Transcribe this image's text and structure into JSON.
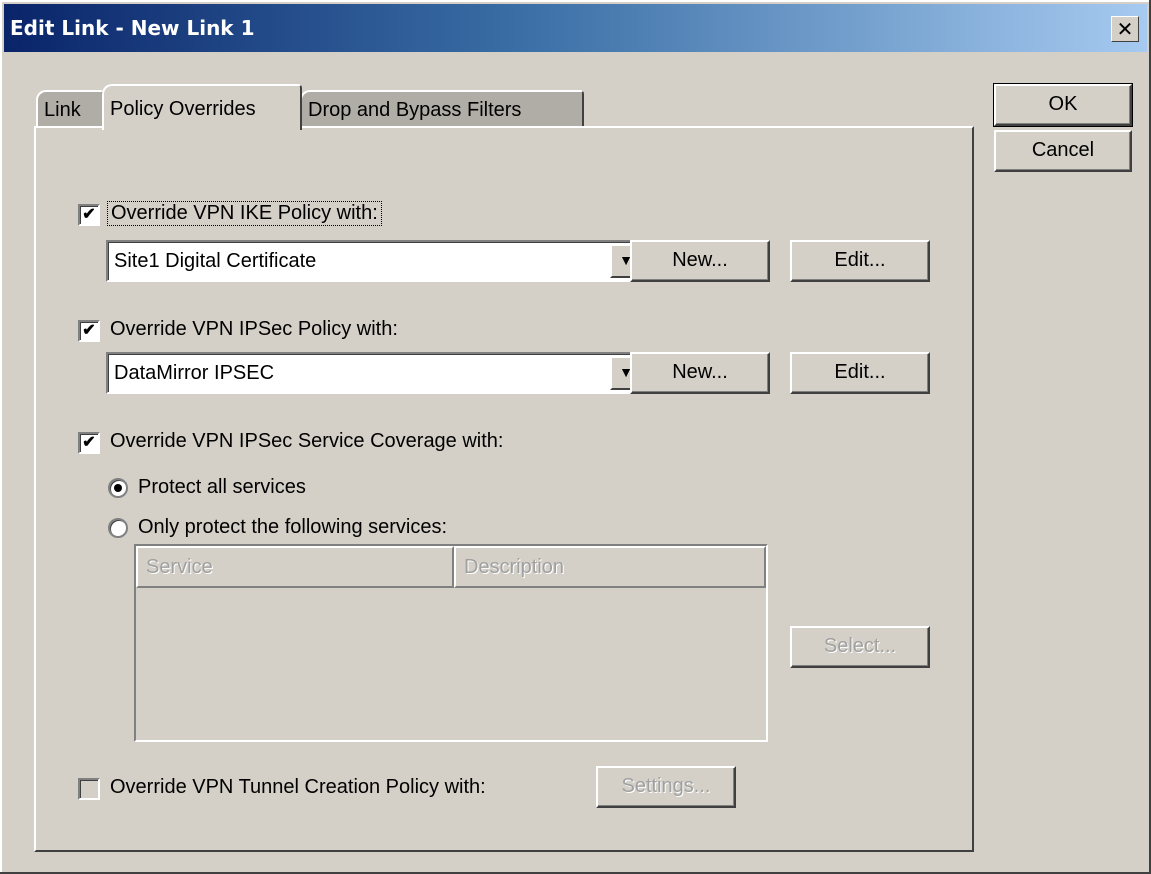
{
  "window": {
    "title": "Edit Link - New Link 1",
    "close_glyph": "✕"
  },
  "buttons": {
    "ok": "OK",
    "cancel": "Cancel"
  },
  "tabs": [
    {
      "label": "Link",
      "active": false
    },
    {
      "label": "Policy Overrides",
      "active": true
    },
    {
      "label": "Drop and Bypass Filters",
      "active": false
    }
  ],
  "ike": {
    "label": "Override VPN IKE Policy with:",
    "checked": true,
    "selected": "Site1 Digital Certificate",
    "new_label": "New...",
    "edit_label": "Edit..."
  },
  "ipsec": {
    "label": "Override VPN IPSec Policy with:",
    "checked": true,
    "selected": "DataMirror IPSEC",
    "new_label": "New...",
    "edit_label": "Edit..."
  },
  "coverage": {
    "label": "Override VPN IPSec Service Coverage with:",
    "checked": true,
    "radio_all": "Protect all services",
    "radio_only": "Only protect the following services:",
    "selected": "all",
    "columns": [
      "Service",
      "Description"
    ],
    "rows": [],
    "select_label": "Select..."
  },
  "tunnel": {
    "label": "Override VPN Tunnel Creation Policy with:",
    "checked": false,
    "settings_label": "Settings..."
  },
  "glyphs": {
    "check": "✔",
    "dropdown": "▼"
  }
}
